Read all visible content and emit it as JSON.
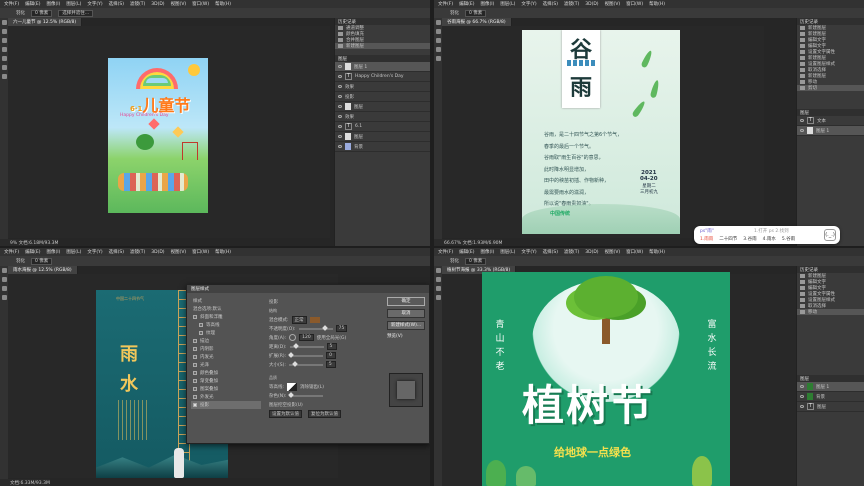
{
  "app": {
    "menu": [
      "文件(F)",
      "编辑(E)",
      "图像(I)",
      "图层(L)",
      "文字(Y)",
      "选择(S)",
      "滤镜(T)",
      "3D(D)",
      "视图(V)",
      "窗口(W)",
      "帮助(H)"
    ],
    "options": {
      "feather_label": "羽化",
      "feather_value": "0 像素",
      "select_mask": "选择并遮住..."
    }
  },
  "q1": {
    "tab_title": "六一儿童节 @ 12.5% (RGB/8)",
    "status": "9% 文档:6.18M/93.3M",
    "layers_tab": "图层",
    "history_tab": "历史记录",
    "history": [
      "通道调整",
      "颜色填充",
      "合并图层",
      "新建图层"
    ],
    "layers": [
      "图层 1",
      "Happy Children's Day",
      "效果",
      "投影",
      "图层",
      "效果",
      "6.1",
      "图层",
      "背景"
    ],
    "poster": {
      "title": "儿童节",
      "badge": "6·1",
      "sub": "Happy   Children's   Day"
    }
  },
  "q2": {
    "tab_title": "谷雨海报 @ 66.7% (RGB/8)",
    "status": "66.67%  文档:1.93M/6.90M",
    "history": [
      "新建图层",
      "新建图层",
      "编辑文字",
      "编辑文字",
      "设置文字属性",
      "新建图层",
      "设置图层样式",
      "取消选择",
      "新建图层",
      "移动",
      "剪切"
    ],
    "layers": [
      "文本",
      "图层 1"
    ],
    "poster": {
      "ch1": "谷",
      "ch2": "雨",
      "lines": [
        "谷雨，是二十四节气之第6个节气，",
        "春季的最后一个节气。",
        "谷雨取\"雨生百谷\"的意思，",
        "此时降水明显增加，",
        "田中的秧苗初插、作物新种，",
        "最需要雨水的滋润，",
        "所以说\"春雨贵如油\"。"
      ],
      "year": "2021",
      "date": "04-20",
      "week": "星期二",
      "lunar": "三月初九",
      "foot": "中国传统"
    }
  },
  "ime": {
    "pinyin": "ps\"雨\"",
    "hint": "1.打开 ps 2.找到",
    "candidates": [
      "1.雨雨",
      "二十四节",
      "3.谷雨",
      "4.雨水",
      "5.谷雨"
    ],
    "face": "(._.)"
  },
  "q3": {
    "tab_title": "雨水海报 @ 12.5% (RGB/8)",
    "status": "文档:6.33M/93.3M",
    "poster": {
      "top": "中国二十四节气",
      "ch1": "雨",
      "ch2": "水"
    },
    "dialog": {
      "title": "图层样式",
      "items": [
        {
          "label": "样式",
          "on": false
        },
        {
          "label": "混合选项:默认",
          "on": false
        },
        {
          "label": "斜面和浮雕",
          "on": false
        },
        {
          "label": "等高线",
          "on": false
        },
        {
          "label": "纹理",
          "on": false
        },
        {
          "label": "描边",
          "on": false
        },
        {
          "label": "内阴影",
          "on": false
        },
        {
          "label": "内发光",
          "on": false
        },
        {
          "label": "光泽",
          "on": false
        },
        {
          "label": "颜色叠加",
          "on": false
        },
        {
          "label": "渐变叠加",
          "on": false
        },
        {
          "label": "图案叠加",
          "on": false
        },
        {
          "label": "外发光",
          "on": false
        },
        {
          "label": "投影",
          "on": true
        }
      ],
      "section": "投影",
      "structure": "结构",
      "rows": [
        {
          "label": "混合模式:",
          "value": "正常"
        },
        {
          "label": "不透明度(O):",
          "value": "75"
        },
        {
          "label": "角度(A):",
          "value": "120",
          "extra": "使用全局光(G)"
        },
        {
          "label": "距离(D):",
          "value": "5"
        },
        {
          "label": "扩展(R):",
          "value": "0"
        },
        {
          "label": "大小(S):",
          "value": "5"
        }
      ],
      "quality": "品质",
      "contour": "等高线:",
      "antialias": "消除锯齿(L)",
      "noise": "杂色(N):",
      "knockout": "图层挖空投影(U)",
      "default1": "设置为默认值",
      "default2": "复位为默认值",
      "ok": "确定",
      "cancel": "取消",
      "new_style": "新建样式(W)...",
      "preview": "预览(V)"
    }
  },
  "q4": {
    "tab_title": "植树节海报 @ 33.3% (RGB/8)",
    "layers": [
      "图层 1",
      "背景",
      "图层"
    ],
    "poster": {
      "left": [
        "青",
        "山",
        "不",
        "老"
      ],
      "right": [
        "富",
        "水",
        "长",
        "流"
      ],
      "title": "植树节",
      "sub": "给地球一点绿色"
    }
  }
}
